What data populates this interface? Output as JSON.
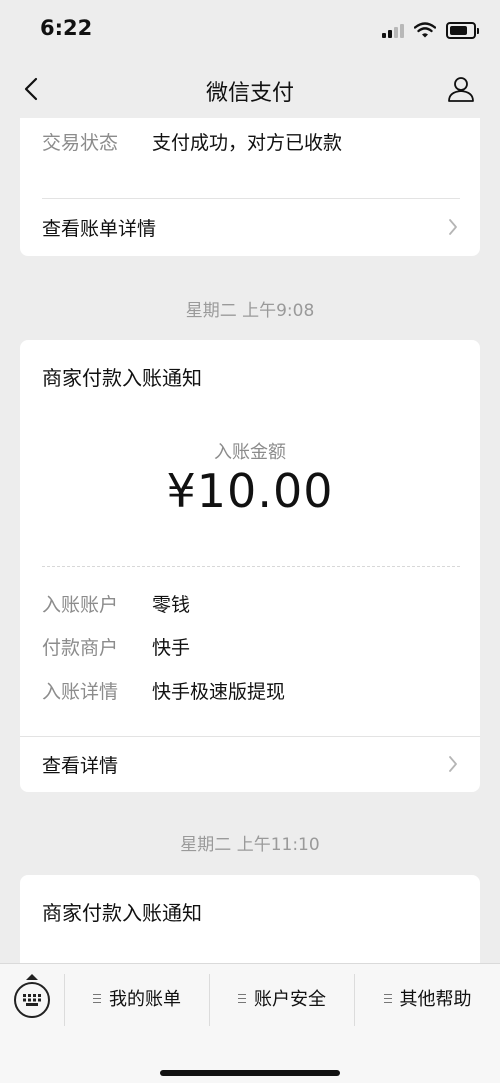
{
  "status_bar": {
    "time": "6:22",
    "battery_level": 0.75
  },
  "nav": {
    "title": "微信支付"
  },
  "card1": {
    "status_label": "交易状态",
    "status_value": "支付成功，对方已收款",
    "link": "查看账单详情"
  },
  "timestamps": [
    "星期二 上午9:08",
    "星期二 上午11:10"
  ],
  "card2": {
    "title": "商家付款入账通知",
    "amount_label": "入账金额",
    "amount": "¥10.00",
    "rows": [
      {
        "label": "入账账户",
        "value": "零钱"
      },
      {
        "label": "付款商户",
        "value": "快手"
      },
      {
        "label": "入账详情",
        "value": "快手极速版提现"
      }
    ],
    "link": "查看详情"
  },
  "card3": {
    "title": "商家付款入账通知"
  },
  "bottom_menu": {
    "items": [
      "我的账单",
      "账户安全",
      "其他帮助"
    ]
  },
  "colors": {
    "background": "#ededed",
    "card": "#ffffff",
    "secondary_text": "#8c8c8c"
  }
}
